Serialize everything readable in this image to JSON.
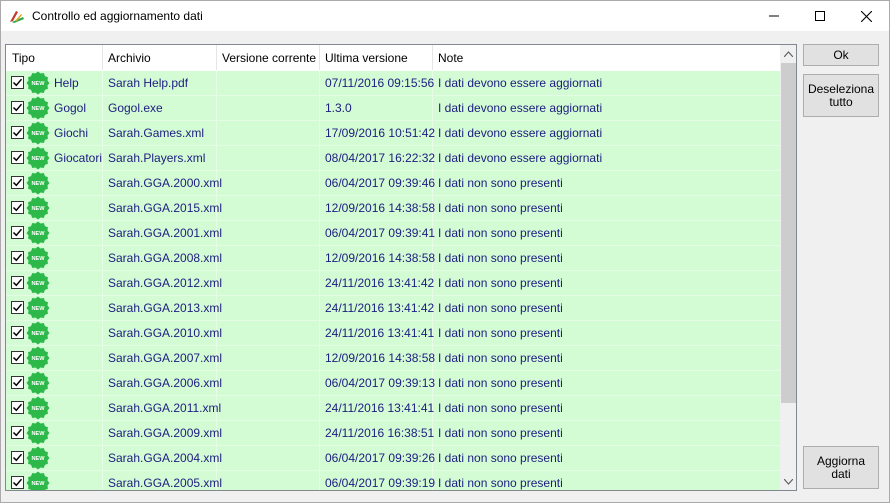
{
  "window": {
    "title": "Controllo ed aggiornamento dati",
    "icon": "app-logo-icon",
    "controls": [
      "minimize-icon",
      "maximize-icon",
      "close-icon"
    ]
  },
  "table": {
    "columns": [
      "Tipo",
      "Archivio",
      "Versione corrente",
      "Ultima versione",
      "Note"
    ],
    "rows": [
      {
        "tipo": "Help",
        "archivio": "Sarah Help.pdf",
        "versione_corrente": "",
        "ultima_versione": "07/11/2016 09:15:56",
        "note": "I dati devono essere aggiornati",
        "checked": true
      },
      {
        "tipo": "Gogol",
        "archivio": "Gogol.exe",
        "versione_corrente": "",
        "ultima_versione": "1.3.0",
        "note": "I dati devono essere aggiornati",
        "checked": true
      },
      {
        "tipo": "Giochi",
        "archivio": "Sarah.Games.xml",
        "versione_corrente": "",
        "ultima_versione": "17/09/2016 10:51:42",
        "note": "I dati devono essere aggiornati",
        "checked": true
      },
      {
        "tipo": "Giocatori",
        "archivio": "Sarah.Players.xml",
        "versione_corrente": "",
        "ultima_versione": "08/04/2017 16:22:32",
        "note": "I dati devono essere aggiornati",
        "checked": true
      },
      {
        "tipo": "",
        "archivio": "Sarah.GGA.2000.xml",
        "versione_corrente": "",
        "ultima_versione": "06/04/2017 09:39:46",
        "note": "I dati non sono presenti",
        "checked": true
      },
      {
        "tipo": "",
        "archivio": "Sarah.GGA.2015.xml",
        "versione_corrente": "",
        "ultima_versione": "12/09/2016 14:38:58",
        "note": "I dati non sono presenti",
        "checked": true
      },
      {
        "tipo": "",
        "archivio": "Sarah.GGA.2001.xml",
        "versione_corrente": "",
        "ultima_versione": "06/04/2017 09:39:41",
        "note": "I dati non sono presenti",
        "checked": true
      },
      {
        "tipo": "",
        "archivio": "Sarah.GGA.2008.xml",
        "versione_corrente": "",
        "ultima_versione": "12/09/2016 14:38:58",
        "note": "I dati non sono presenti",
        "checked": true
      },
      {
        "tipo": "",
        "archivio": "Sarah.GGA.2012.xml",
        "versione_corrente": "",
        "ultima_versione": "24/11/2016 13:41:42",
        "note": "I dati non sono presenti",
        "checked": true
      },
      {
        "tipo": "",
        "archivio": "Sarah.GGA.2013.xml",
        "versione_corrente": "",
        "ultima_versione": "24/11/2016 13:41:42",
        "note": "I dati non sono presenti",
        "checked": true
      },
      {
        "tipo": "",
        "archivio": "Sarah.GGA.2010.xml",
        "versione_corrente": "",
        "ultima_versione": "24/11/2016 13:41:41",
        "note": "I dati non sono presenti",
        "checked": true
      },
      {
        "tipo": "",
        "archivio": "Sarah.GGA.2007.xml",
        "versione_corrente": "",
        "ultima_versione": "12/09/2016 14:38:58",
        "note": "I dati non sono presenti",
        "checked": true
      },
      {
        "tipo": "",
        "archivio": "Sarah.GGA.2006.xml",
        "versione_corrente": "",
        "ultima_versione": "06/04/2017 09:39:13",
        "note": "I dati non sono presenti",
        "checked": true
      },
      {
        "tipo": "",
        "archivio": "Sarah.GGA.2011.xml",
        "versione_corrente": "",
        "ultima_versione": "24/11/2016 13:41:41",
        "note": "I dati non sono presenti",
        "checked": true
      },
      {
        "tipo": "",
        "archivio": "Sarah.GGA.2009.xml",
        "versione_corrente": "",
        "ultima_versione": "24/11/2016 16:38:51",
        "note": "I dati non sono presenti",
        "checked": true
      },
      {
        "tipo": "",
        "archivio": "Sarah.GGA.2004.xml",
        "versione_corrente": "",
        "ultima_versione": "06/04/2017 09:39:26",
        "note": "I dati non sono presenti",
        "checked": true
      },
      {
        "tipo": "",
        "archivio": "Sarah.GGA.2005.xml",
        "versione_corrente": "",
        "ultima_versione": "06/04/2017 09:39:19",
        "note": "I dati non sono presenti",
        "checked": true
      }
    ],
    "badge_text": "NEW",
    "row_color": "#d4fcd4",
    "text_color": "#1c1c80",
    "badge_color": "#2db84a"
  },
  "buttons": {
    "ok": "Ok",
    "deseleziona": "Deseleziona\ntutto",
    "aggiorna": "Aggiorna\ndati"
  }
}
